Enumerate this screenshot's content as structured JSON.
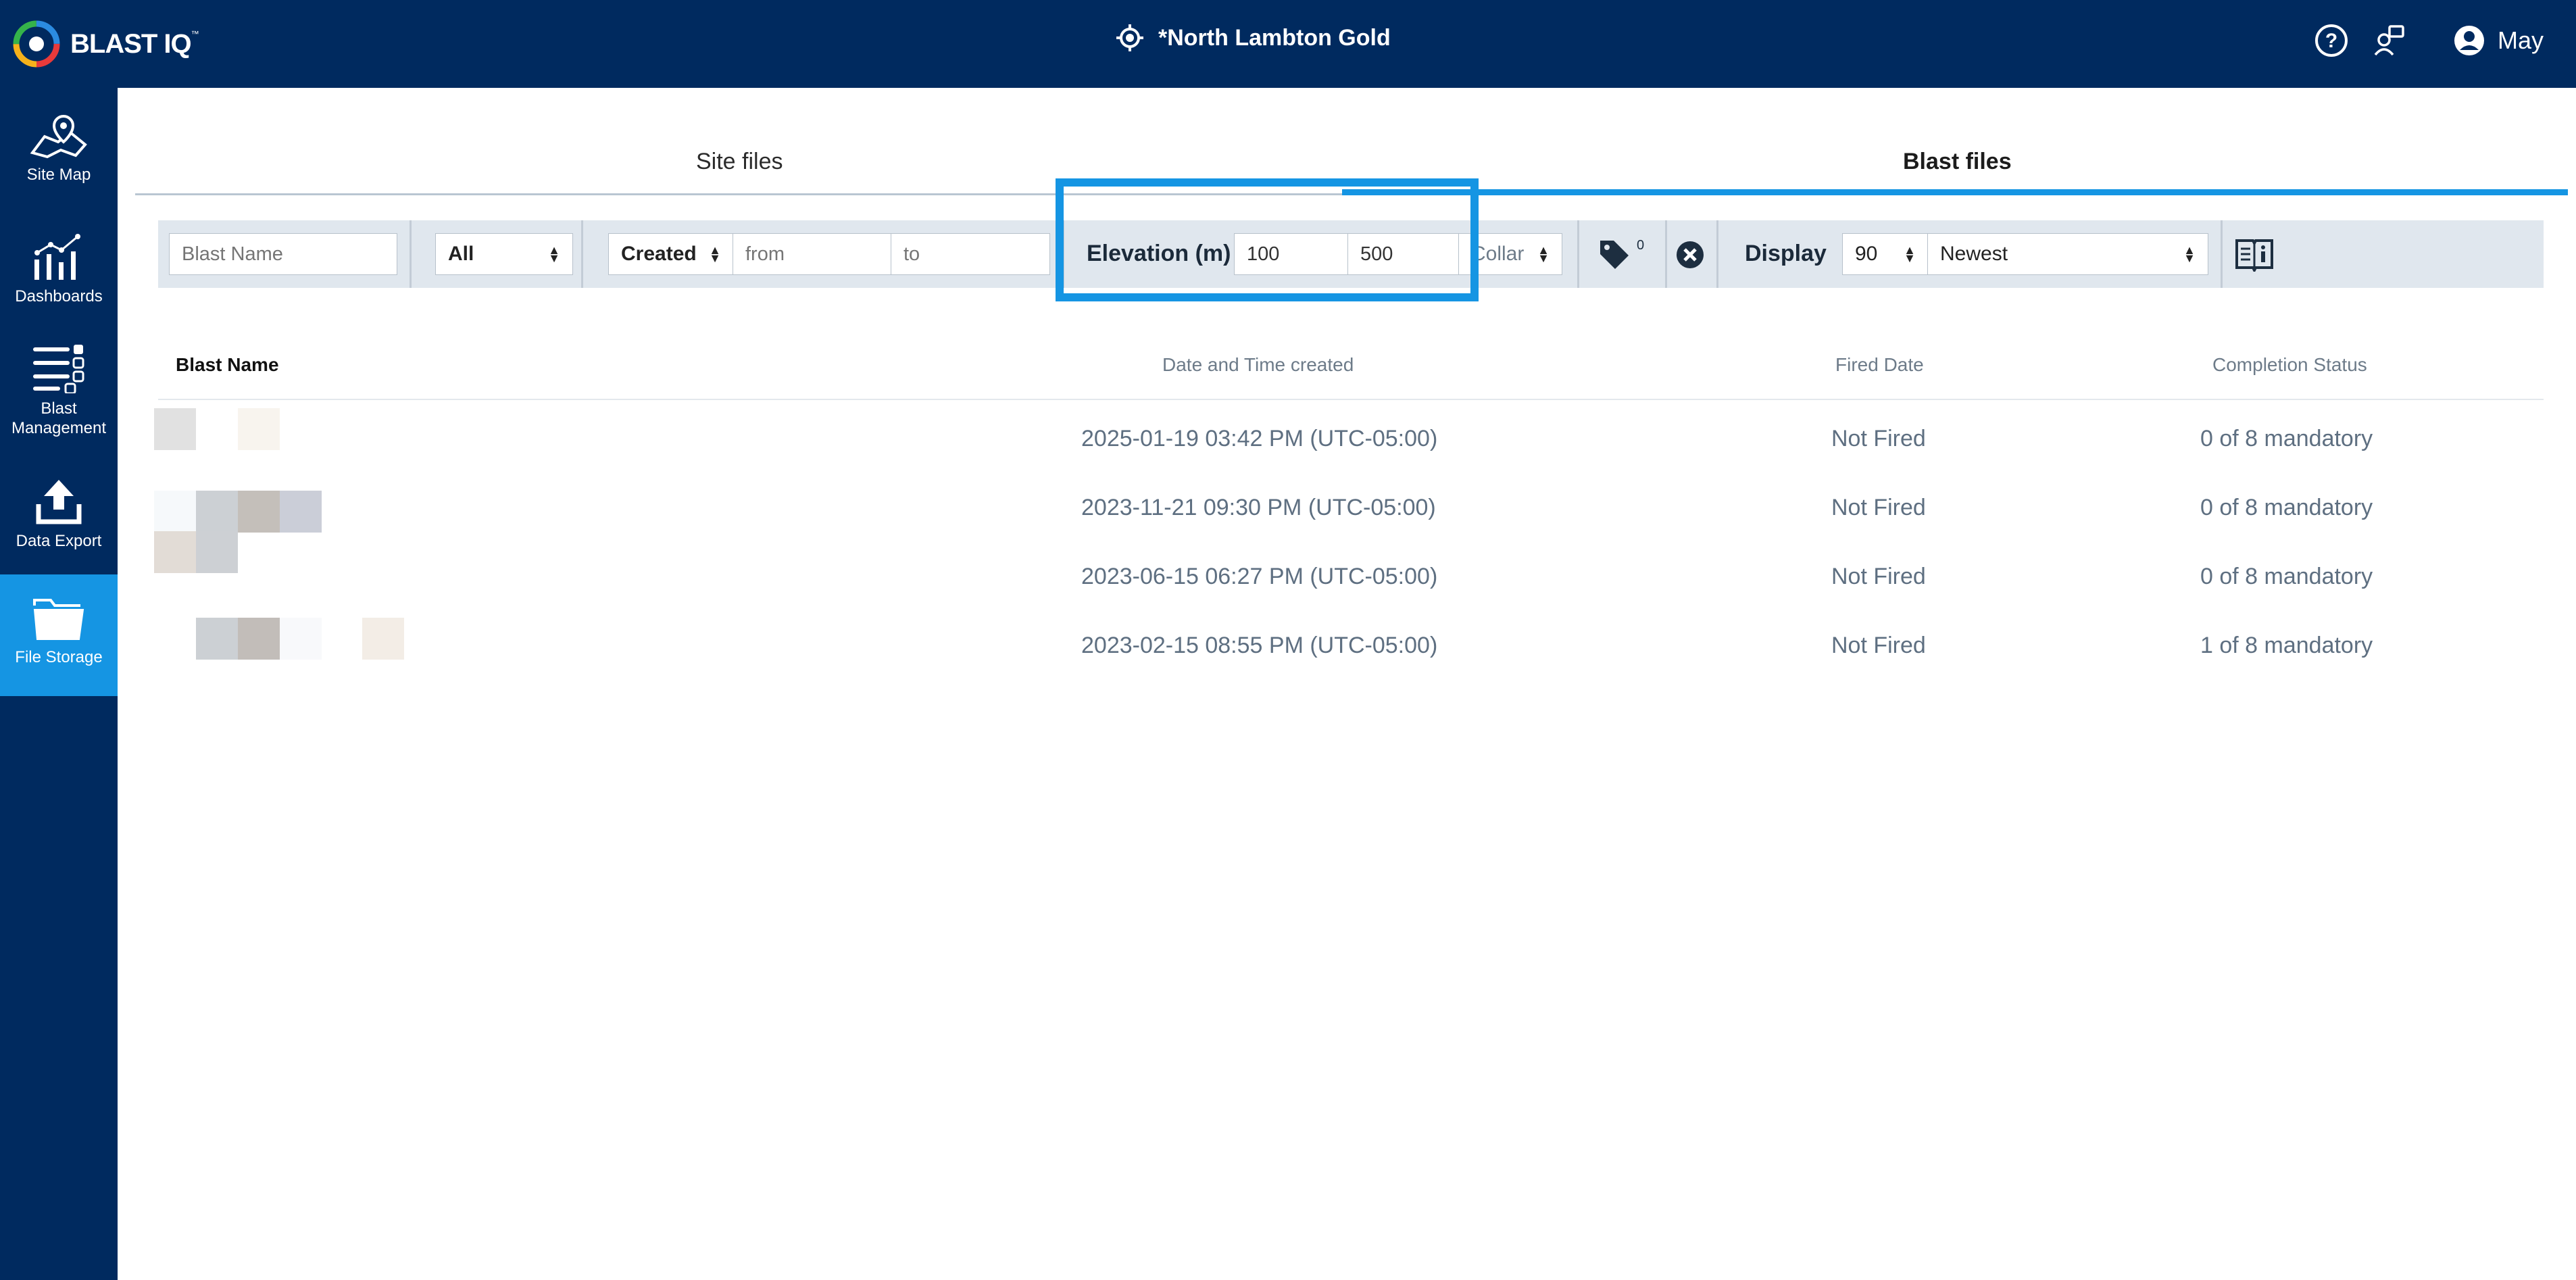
{
  "header": {
    "logo_text": "BLAST IQ",
    "logo_tm": "™",
    "site_name": "*North Lambton Gold",
    "user_name": "May",
    "icons": [
      "locate-icon",
      "help-icon",
      "support-chat-icon",
      "user-avatar-icon"
    ]
  },
  "sidebar": {
    "items": [
      {
        "label": "Site Map",
        "icon": "map-pin-icon"
      },
      {
        "label": "Dashboards",
        "icon": "chart-icon"
      },
      {
        "label": "Blast\nManagement",
        "label_line1": "Blast",
        "label_line2": "Management",
        "icon": "list-checks-icon"
      },
      {
        "label": "Data Export",
        "icon": "upload-icon"
      },
      {
        "label": "File Storage",
        "icon": "folder-icon",
        "active": true
      }
    ]
  },
  "tabs": [
    {
      "label": "Site files",
      "active": false
    },
    {
      "label": "Blast files",
      "active": true
    }
  ],
  "filters": {
    "blast_name_placeholder": "Blast Name",
    "type_select": "All",
    "date_select": "Created",
    "from_placeholder": "from",
    "to_placeholder": "to",
    "elevation_label": "Elevation (m)",
    "elevation_min": "100",
    "elevation_max": "500",
    "elevation_ref_select": "Collar",
    "tag_count": "0",
    "display_label": "Display",
    "display_count": "90",
    "sort_select": "Newest"
  },
  "table": {
    "columns": [
      "Blast Name",
      "Date and Time created",
      "Fired Date",
      "Completion Status"
    ],
    "rows": [
      {
        "date": "2025-01-19 03:42 PM (UTC-05:00)",
        "fired": "Not Fired",
        "status": "0 of 8 mandatory"
      },
      {
        "date": "2023-11-21 09:30 PM (UTC-05:00)",
        "fired": "Not Fired",
        "status": "0 of 8 mandatory"
      },
      {
        "date": "2023-06-15 06:27 PM (UTC-05:00)",
        "fired": "Not Fired",
        "status": "0 of 8 mandatory"
      },
      {
        "date": "2023-02-15 08:55 PM (UTC-05:00)",
        "fired": "Not Fired",
        "status": "1 of 8 mandatory"
      }
    ]
  },
  "colors": {
    "navy": "#002a5f",
    "accent": "#1595e3",
    "filter_bg": "#e0e7ee"
  }
}
